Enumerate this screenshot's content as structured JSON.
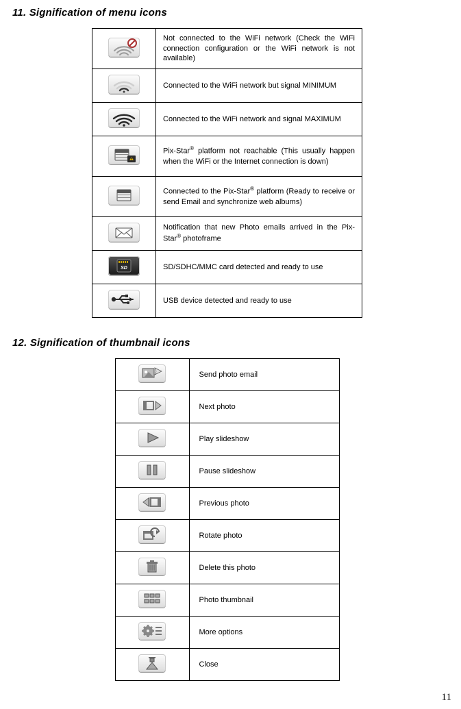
{
  "sections": {
    "s11": {
      "title": "11. Signification of menu icons"
    },
    "s12": {
      "title": "12. Signification of thumbnail icons"
    }
  },
  "menu": [
    {
      "icon": "wifi-off-icon",
      "text": "Not connected to the WiFi network (Check the WiFi connection configuration or the WiFi network is not available)"
    },
    {
      "icon": "wifi-min-icon",
      "text": "Connected to the WiFi network but signal MINIMUM"
    },
    {
      "icon": "wifi-max-icon",
      "text": "Connected to the WiFi network and signal MAXIMUM"
    },
    {
      "icon": "server-down-icon",
      "text_html": "Pix-Star<sup>®</sup> platform not reachable (This usually happen when the WiFi or the Internet connection is down)"
    },
    {
      "icon": "server-up-icon",
      "text_html": " Connected to the Pix-Star<sup>®</sup> platform (Ready to receive or send Email and synchronize web albums)"
    },
    {
      "icon": "mail-icon",
      "text_html": "Notification that new Photo emails arrived in the Pix-Star<sup>®</sup> photoframe"
    },
    {
      "icon": "sd-card-icon",
      "text": "SD/SDHC/MMC card detected and ready to use"
    },
    {
      "icon": "usb-icon",
      "text": "USB device detected and ready to use"
    }
  ],
  "thumb": [
    {
      "icon": "send-email-icon",
      "text": "Send photo email"
    },
    {
      "icon": "next-icon",
      "text": "Next photo"
    },
    {
      "icon": "play-icon",
      "text": "Play slideshow"
    },
    {
      "icon": "pause-icon",
      "text": "Pause slideshow"
    },
    {
      "icon": "prev-icon",
      "text": "Previous photo"
    },
    {
      "icon": "rotate-icon",
      "text": "Rotate photo"
    },
    {
      "icon": "delete-icon",
      "text": "Delete this photo"
    },
    {
      "icon": "grid-icon",
      "text": "Photo thumbnail"
    },
    {
      "icon": "options-icon",
      "text": "More options"
    },
    {
      "icon": "close-icon",
      "text": "Close"
    }
  ],
  "page_number": "11"
}
